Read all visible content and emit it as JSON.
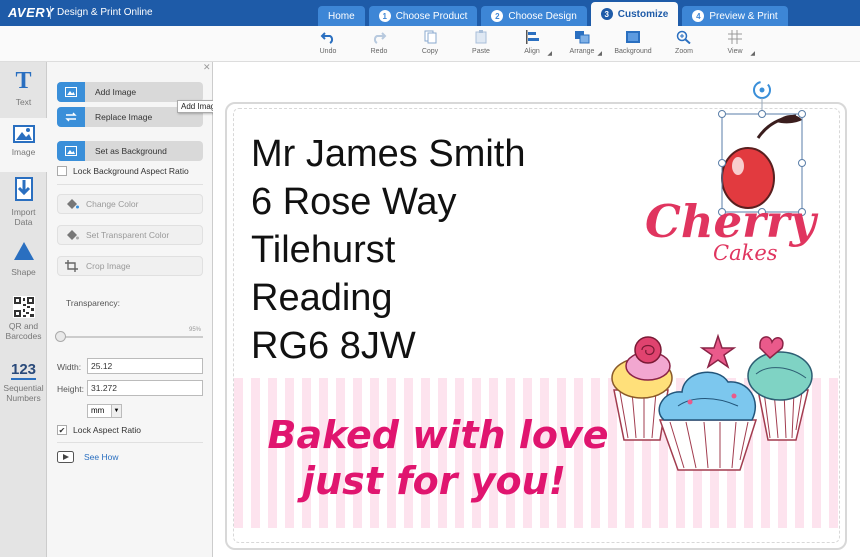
{
  "header": {
    "brand": "AVERY",
    "subtitle": "Design & Print Online",
    "tabs": [
      {
        "num": "",
        "label": "Home"
      },
      {
        "num": "1",
        "label": "Choose Product"
      },
      {
        "num": "2",
        "label": "Choose Design"
      },
      {
        "num": "3",
        "label": "Customize"
      },
      {
        "num": "4",
        "label": "Preview & Print"
      }
    ],
    "active_tab": "Customize"
  },
  "toolbar": {
    "undo": "Undo",
    "redo": "Redo",
    "copy": "Copy",
    "paste": "Paste",
    "align": "Align",
    "arrange": "Arrange",
    "background": "Background",
    "zoom": "Zoom",
    "view": "View"
  },
  "rail": {
    "text": "Text",
    "text_glyph": "T",
    "image": "Image",
    "import_data": "Import\nData",
    "shape": "Shape",
    "qr": "QR and\nBarcodes",
    "seq_glyph": "123",
    "sequential": "Sequential\nNumbers"
  },
  "panel": {
    "add_image": "Add Image",
    "replace_image": "Replace Image",
    "set_background": "Set as Background",
    "lock_bg_ratio": "Lock Background Aspect Ratio",
    "change_color": "Change Color",
    "set_transparent": "Set Transparent Color",
    "crop_image": "Crop Image",
    "transparency_label": "Transparency:",
    "transparency_value_text": "95%",
    "transparency_value": 0,
    "width_label": "Width:",
    "width_value": "25.12",
    "height_label": "Height:",
    "height_value": "31.272",
    "unit": "mm",
    "lock_aspect": "Lock Aspect Ratio",
    "lock_aspect_checked": true,
    "see_how": "See How",
    "tooltip": "Add Image"
  },
  "label": {
    "address": [
      "Mr James Smith",
      "6 Rose Way",
      "Tilehurst",
      "Reading",
      "RG6 8JW"
    ],
    "tagline_1": "Baked with love",
    "tagline_2": "just for you!",
    "logo_word": "Cherry",
    "logo_sub": "Cakes"
  },
  "colors": {
    "header_blue": "#1e5ba8",
    "tab_blue": "#3d86d6",
    "button_blue": "#3a8fd9",
    "tagline_pink": "#e0156f",
    "logo_red": "#e0355f",
    "stripe_pink": "#fde3ee"
  }
}
